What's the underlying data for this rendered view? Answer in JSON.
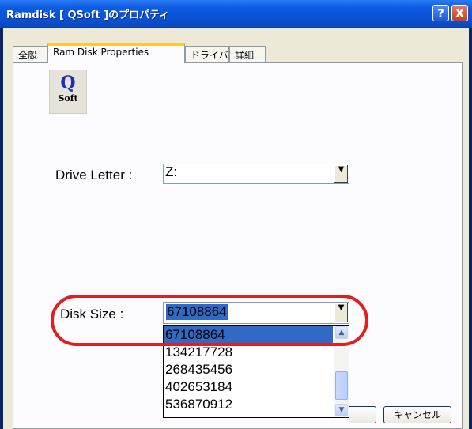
{
  "window": {
    "title": "Ramdisk [ QSoft ]のプロパティ",
    "help_label": "?",
    "close_label": "X"
  },
  "tabs": [
    {
      "label": "全般"
    },
    {
      "label": "Ram Disk Properties",
      "active": true
    },
    {
      "label": "ドライバ"
    },
    {
      "label": "詳細"
    }
  ],
  "logo": {
    "icon": "qsoft-logo-icon",
    "letter": "Q",
    "sub": "Soft"
  },
  "drive_letter": {
    "label": "Drive Letter :",
    "value": "Z:"
  },
  "disk_size": {
    "label": "Disk Size :",
    "value": "67108864",
    "options": [
      "67108864",
      "134217728",
      "268435456",
      "402653184",
      "536870912"
    ],
    "selected_index": 0
  },
  "footer": {
    "cancel_label": "キャンセル"
  },
  "colors": {
    "highlight": "#316AC5",
    "annotation": "#E02020",
    "tab_accent": "#FFC83C"
  }
}
